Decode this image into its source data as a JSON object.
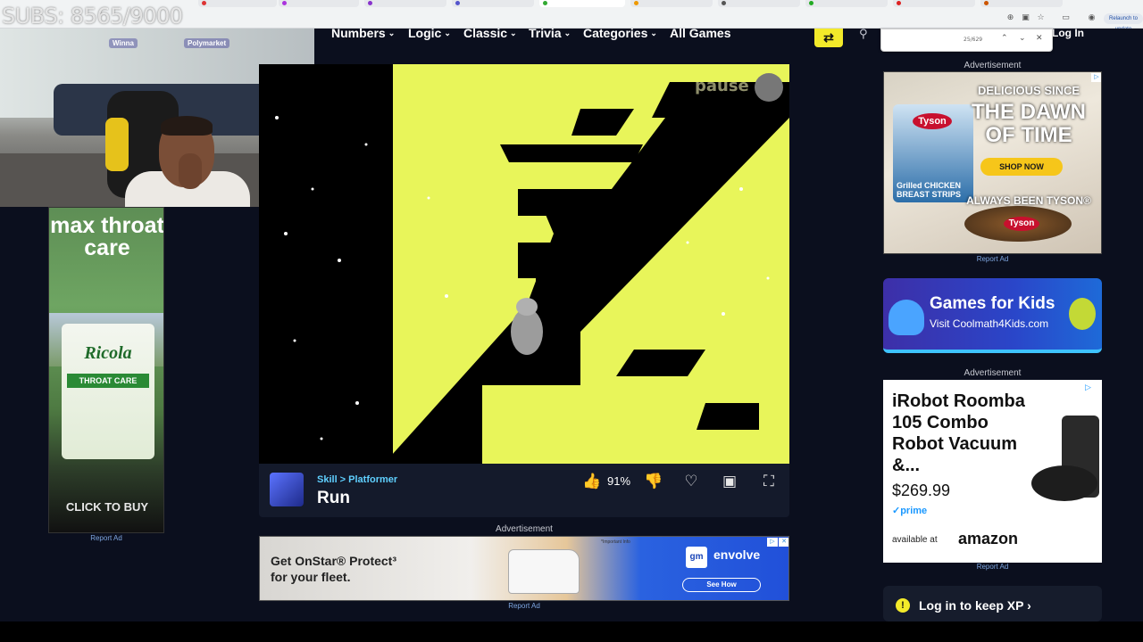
{
  "overlay": {
    "subs": "SUBS: 8565/9000"
  },
  "webcam": {
    "logo1": "Winna",
    "logo2": "Polymarket"
  },
  "browser": {
    "tabs": [
      "",
      "",
      "",
      "",
      "",
      "",
      "",
      "",
      "",
      "",
      "",
      "",
      "",
      "",
      "",
      ""
    ],
    "find_count": "25/629",
    "relaunch": "Relaunch to update"
  },
  "nav": {
    "items": [
      "Numbers",
      "Logic",
      "Classic",
      "Trivia",
      "Categories"
    ],
    "all_games": "All Games",
    "login": "Log In"
  },
  "game": {
    "pause": "pause",
    "category": "Skill > Platformer",
    "title": "Run",
    "rating": "91%",
    "colors": {
      "tunnel": "#e8f55a",
      "bg": "#000000"
    }
  },
  "ads": {
    "label": "Advertisement",
    "report": "Report Ad",
    "left": {
      "headline": "max throat care",
      "brand": "Ricola",
      "product": "THROAT CARE",
      "cta": "CLICK TO BUY"
    },
    "bottom": {
      "text1": "Get OnStar® Protect³",
      "text2": "for your fleet.",
      "info": "*Important Info",
      "gm": "gm",
      "brand": "envolve",
      "cta": "See How"
    },
    "tyson": {
      "h1": "DELICIOUS SINCE",
      "h2": "THE DAWN OF TIME",
      "cta": "SHOP NOW",
      "tagline": "ALWAYS BEEN TYSON®",
      "logo": "Tyson",
      "pack": "Grilled CHICKEN BREAST STRIPS"
    },
    "kids": {
      "title": "Games for Kids",
      "sub": "Visit Coolmath4Kids.com"
    },
    "roomba": {
      "title": "iRobot Roomba 105 Combo Robot Vacuum &...",
      "price": "$269.99",
      "prime": "✓prime",
      "available": "available at",
      "amazon": "amazon"
    }
  },
  "xp": {
    "text": "Log in to keep XP"
  }
}
